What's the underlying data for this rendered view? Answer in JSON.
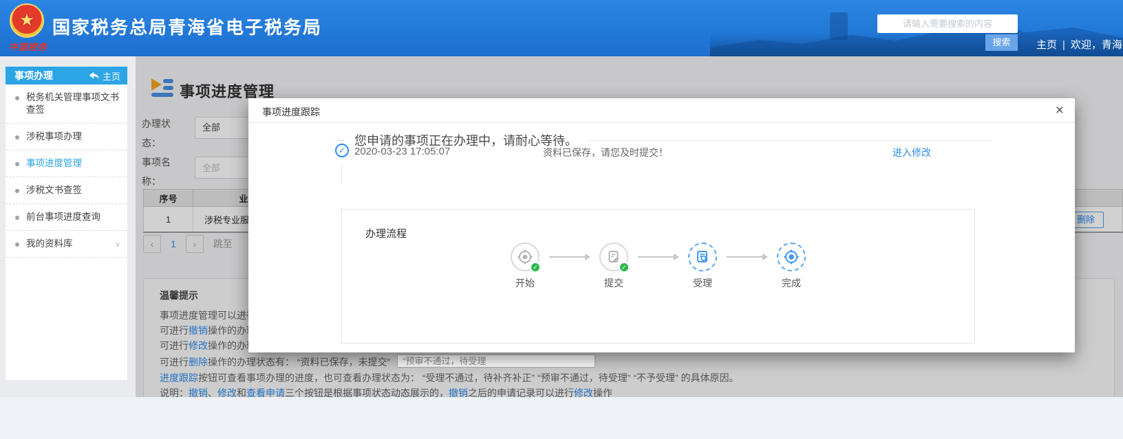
{
  "colors": {
    "header_blue": "#2279d8",
    "sidebar_blue": "#2ba5e6",
    "link_blue": "#2d8cf0",
    "success_green": "#2eb84e",
    "icon_orange": "#f5a623"
  },
  "header": {
    "title": "国家税务总局青海省电子税务局",
    "logo_caption": "中国税务",
    "emblem_star": "★",
    "search_placeholder": "请输入需要搜索的内容",
    "search_button": "搜索",
    "home_link": "主页",
    "separator": "|",
    "welcome_text": "欢迎，青海羚"
  },
  "sidebar": {
    "header_title": "事项办理",
    "header_home": "主页",
    "items": [
      {
        "label": "税务机关管理事项文书查签"
      },
      {
        "label": "涉税事项办理"
      },
      {
        "label": "事项进度管理"
      },
      {
        "label": "涉税文书查签"
      },
      {
        "label": "前台事项进度查询"
      },
      {
        "label": "我的资料库"
      }
    ],
    "chevron": "∨"
  },
  "main": {
    "page_title": "事项进度管理",
    "filters": {
      "status_label": "办理状态：",
      "status_value": "全部",
      "name_label": "事项名称：",
      "name_placeholder": "全部"
    },
    "table": {
      "header_seq": "序号",
      "header_business": "业务",
      "row_seq": "1",
      "row_business": "涉税专业服务",
      "delete_button": "删除"
    },
    "pagination": {
      "prev": "‹",
      "page": "1",
      "next": "›",
      "jump_label": "跳至"
    },
    "tips": {
      "title": "温馨提示",
      "line1": "事项进度管理可以进行",
      "line2_pre": "可进行",
      "line2_link": "撤销",
      "line2_post": "操作的办理",
      "line3_pre": "可进行",
      "line3_link": "修改",
      "line3_post": "操作的办理",
      "line4_pre": "可进行",
      "line4_link": "删除",
      "line4_post": "操作的办理状态有： “资料已保存，未提交”",
      "line4_box": "“预审不通过，待受理",
      "line5_link": "进度跟踪",
      "line5_post": "按钮可查看事项办理的进度，也可查看办理状态为： “受理不通过，待补齐补正” “预审不通过，待受理” “不予受理” 的具体原因。",
      "note_prefix": "说明：",
      "note_link1": "撤销",
      "note_sep1": "、",
      "note_link2": "修改",
      "note_and": "和",
      "note_link3": "查看申请",
      "note_mid": "三个按钮是根据事项状态动态展示的，",
      "note_link4": "撤销",
      "note_mid2": "之后的申请记录可以进行",
      "note_link5": "修改",
      "note_suffix": "操作"
    }
  },
  "modal": {
    "title": "事项进度跟踪",
    "close": "×",
    "message": "您申请的事项正在办理中，请耐心等待。",
    "check_glyph": "✓",
    "timeline": {
      "timestamp": "2020-03-23 17:05:07",
      "status": "资料已保存，请您及时提交！",
      "action": "进入修改"
    },
    "flow": {
      "title": "办理流程",
      "badge_glyph": "✓",
      "steps": [
        {
          "label": "开始"
        },
        {
          "label": "提交"
        },
        {
          "label": "受理"
        },
        {
          "label": "完成"
        }
      ]
    }
  }
}
